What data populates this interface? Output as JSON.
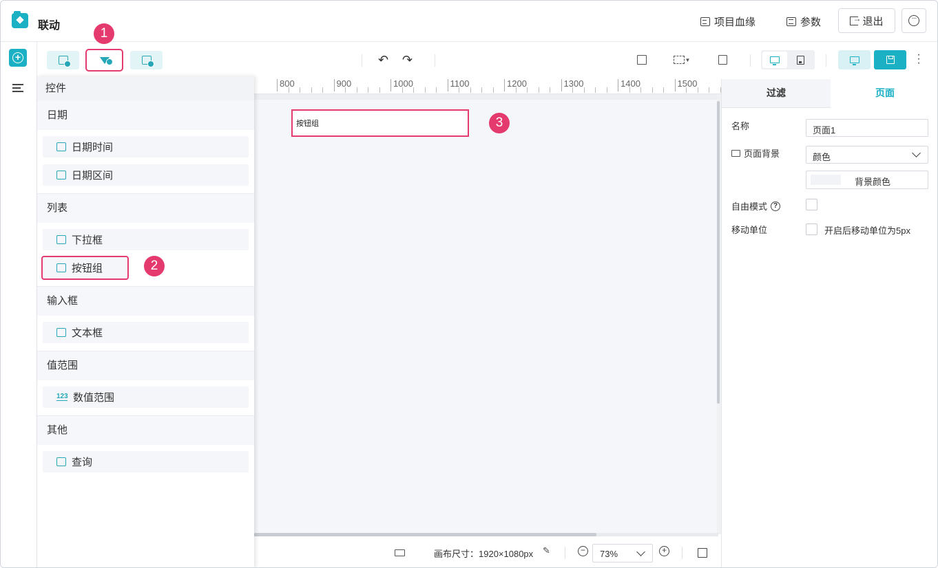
{
  "header": {
    "title": "联动",
    "lineage_label": "项目血缘",
    "params_label": "参数",
    "exit_label": "退出"
  },
  "annotations": [
    "1",
    "2",
    "3"
  ],
  "component_panel": {
    "title": "控件",
    "categories": [
      {
        "title": "日期",
        "items": [
          {
            "label": "日期时间",
            "icon": "calendar-icon"
          },
          {
            "label": "日期区间",
            "icon": "calendar-range-icon"
          }
        ]
      },
      {
        "title": "列表",
        "items": [
          {
            "label": "下拉框",
            "icon": "dropdown-icon"
          },
          {
            "label": "按钮组",
            "icon": "button-group-icon"
          }
        ]
      },
      {
        "title": "输入框",
        "items": [
          {
            "label": "文本框",
            "icon": "textbox-icon"
          }
        ]
      },
      {
        "title": "值范围",
        "items": [
          {
            "label": "数值范围",
            "icon": "number-range-icon",
            "glyph": "123"
          }
        ]
      },
      {
        "title": "其他",
        "items": [
          {
            "label": "查询",
            "icon": "query-icon"
          }
        ]
      }
    ]
  },
  "ruler": {
    "labels": [
      "800",
      "900",
      "1000",
      "1100",
      "1200",
      "1300",
      "1400",
      "1500"
    ]
  },
  "canvas": {
    "widget_label": "按钮组"
  },
  "statusbar": {
    "canvas_size": "画布尺寸：1920×1080px",
    "zoom": "73%"
  },
  "props": {
    "tabs": [
      "过滤",
      "页面"
    ],
    "active_tab": "页面",
    "name_label": "名称",
    "name_value": "页面1",
    "bg_label": "页面背景",
    "bg_value": "颜色",
    "bg_color_button": "背景颜色",
    "free_mode_label": "自由模式",
    "move_unit_label": "移动单位",
    "move_unit_hint": "开启后移动单位为5px"
  },
  "colors": {
    "accent": "#1bb0c4",
    "highlight": "#e43a6e"
  }
}
